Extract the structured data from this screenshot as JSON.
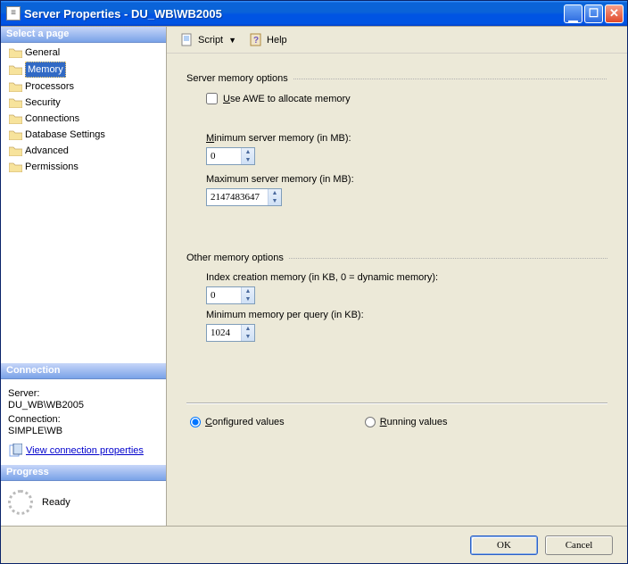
{
  "window": {
    "title": "Server Properties - DU_WB\\WB2005"
  },
  "sidebar": {
    "select_page_header": "Select a page",
    "pages": [
      {
        "label": "General"
      },
      {
        "label": "Memory"
      },
      {
        "label": "Processors"
      },
      {
        "label": "Security"
      },
      {
        "label": "Connections"
      },
      {
        "label": "Database Settings"
      },
      {
        "label": "Advanced"
      },
      {
        "label": "Permissions"
      }
    ],
    "selected_index": 1,
    "connection_header": "Connection",
    "conn_server_label": "Server:",
    "conn_server_value": "DU_WB\\WB2005",
    "conn_connection_label": "Connection:",
    "conn_connection_value": "SIMPLE\\WB",
    "view_conn_label": "View connection properties",
    "progress_header": "Progress",
    "progress_status": "Ready"
  },
  "toolbar": {
    "script_label": "Script",
    "help_label": "Help"
  },
  "content": {
    "server_mem_title": "Server memory options",
    "use_awe_label": "Use AWE to allocate memory",
    "min_mem_label": "Minimum server memory (in MB):",
    "min_mem_value": "0",
    "max_mem_label": "Maximum server memory (in MB):",
    "max_mem_value": "2147483647",
    "other_mem_title": "Other memory options",
    "idx_mem_label": "Index creation memory (in KB, 0 = dynamic memory):",
    "idx_mem_value": "0",
    "min_query_label": "Minimum memory per query (in KB):",
    "min_query_value": "1024",
    "configured_label": "Configured values",
    "running_label": "Running values"
  },
  "footer": {
    "ok": "OK",
    "cancel": "Cancel"
  }
}
